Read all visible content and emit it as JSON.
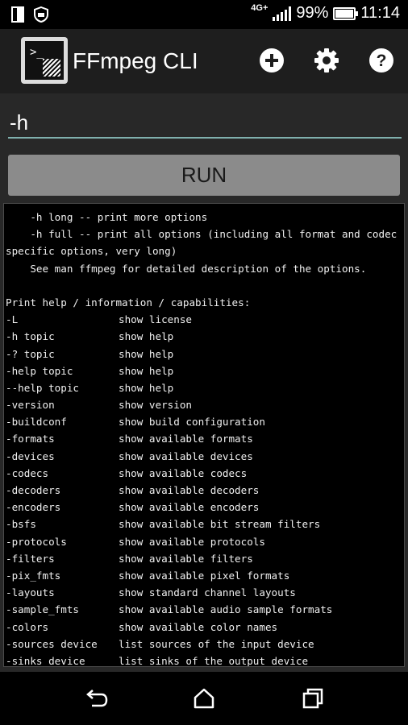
{
  "status_bar": {
    "network": "4G+",
    "battery_percent": "99%",
    "time": "11:14",
    "icons": [
      "sim-icon",
      "shield-icon",
      "signal-icon",
      "battery-icon"
    ]
  },
  "app_bar": {
    "title": "FFmpeg CLI",
    "actions": [
      "add-icon",
      "settings-icon",
      "help-icon"
    ]
  },
  "command": {
    "value": "-h"
  },
  "run_button": {
    "label": "RUN"
  },
  "output": {
    "lines": [
      {
        "type": "text",
        "text": "    -h long -- print more options"
      },
      {
        "type": "text",
        "text": "    -h full -- print all options (including all format and codec"
      },
      {
        "type": "text",
        "text": "specific options, very long)"
      },
      {
        "type": "text",
        "text": "    See man ffmpeg for detailed description of the options."
      },
      {
        "type": "text",
        "text": ""
      },
      {
        "type": "text",
        "text": "Print help / information / capabilities:"
      },
      {
        "type": "opt",
        "option": "-L",
        "desc": "show license"
      },
      {
        "type": "opt",
        "option": "-h topic",
        "desc": "show help"
      },
      {
        "type": "opt",
        "option": "-? topic",
        "desc": "show help"
      },
      {
        "type": "opt",
        "option": "-help topic",
        "desc": "show help"
      },
      {
        "type": "opt",
        "option": "--help topic",
        "desc": "show help"
      },
      {
        "type": "opt",
        "option": "-version",
        "desc": "show version"
      },
      {
        "type": "opt",
        "option": "-buildconf",
        "desc": "show build configuration"
      },
      {
        "type": "opt",
        "option": "-formats",
        "desc": "show available formats"
      },
      {
        "type": "opt",
        "option": "-devices",
        "desc": "show available devices"
      },
      {
        "type": "opt",
        "option": "-codecs",
        "desc": "show available codecs"
      },
      {
        "type": "opt",
        "option": "-decoders",
        "desc": "show available decoders"
      },
      {
        "type": "opt",
        "option": "-encoders",
        "desc": "show available encoders"
      },
      {
        "type": "opt",
        "option": "-bsfs",
        "desc": "show available bit stream filters"
      },
      {
        "type": "opt",
        "option": "-protocols",
        "desc": "show available protocols"
      },
      {
        "type": "opt",
        "option": "-filters",
        "desc": "show available filters"
      },
      {
        "type": "opt",
        "option": "-pix_fmts",
        "desc": "show available pixel formats"
      },
      {
        "type": "opt",
        "option": "-layouts",
        "desc": "show standard channel layouts"
      },
      {
        "type": "opt",
        "option": "-sample_fmts",
        "desc": "show available audio sample formats"
      },
      {
        "type": "opt",
        "option": "-colors",
        "desc": "show available color names"
      },
      {
        "type": "opt",
        "option": "-sources device",
        "desc": "list sources of the input device"
      },
      {
        "type": "opt",
        "option": "-sinks device",
        "desc": "list sinks of the output device"
      }
    ]
  },
  "nav_bar": {
    "buttons": [
      "back-icon",
      "home-icon",
      "recents-icon"
    ]
  },
  "colors": {
    "accent": "#7fb0ad",
    "run_button_bg": "#8b8b8b",
    "background": "#282828"
  }
}
